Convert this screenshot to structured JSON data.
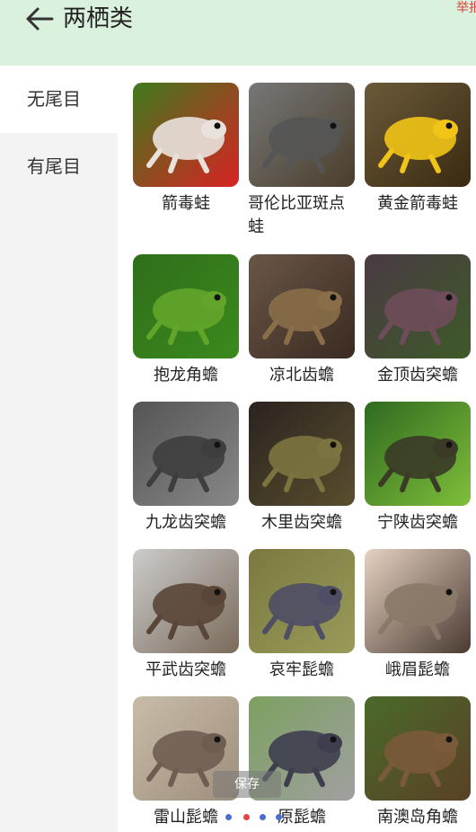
{
  "header": {
    "title": "两栖类",
    "report": "举报"
  },
  "sidebar": {
    "items": [
      {
        "label": "无尾目"
      },
      {
        "label": "有尾目"
      }
    ]
  },
  "species": [
    {
      "name": "箭毒蛙"
    },
    {
      "name": "哥伦比亚斑点蛙"
    },
    {
      "name": "黄金箭毒蛙"
    },
    {
      "name": "抱龙角蟾"
    },
    {
      "name": "凉北齿蟾"
    },
    {
      "name": "金顶齿突蟾"
    },
    {
      "name": "九龙齿突蟾"
    },
    {
      "name": "木里齿突蟾"
    },
    {
      "name": "宁陕齿突蟾"
    },
    {
      "name": "平武齿突蟾"
    },
    {
      "name": "哀牢髭蟾"
    },
    {
      "name": "峨眉髭蟾"
    },
    {
      "name": "雷山髭蟾"
    },
    {
      "name": "原髭蟾"
    },
    {
      "name": "南澳岛角蟾"
    }
  ],
  "overlay": {
    "save_label": "保存"
  },
  "colors": {
    "header_bg": "#d9f1dd",
    "sidebar_bg": "#f3f3f3",
    "report": "#d9443a"
  }
}
